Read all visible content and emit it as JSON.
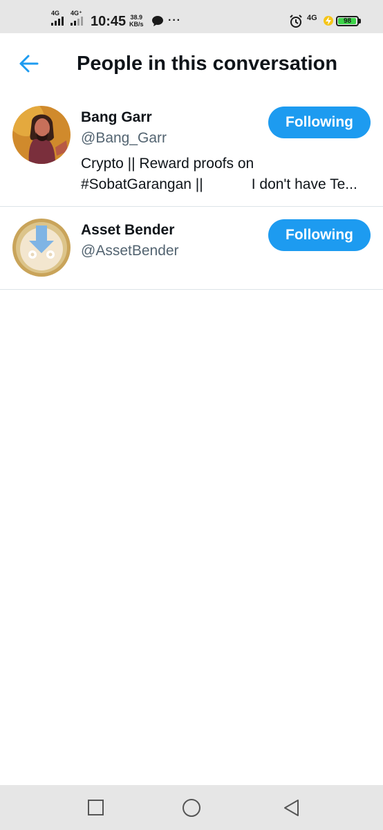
{
  "status_bar": {
    "network_1": "4G",
    "network_2": "4G⁺",
    "time": "10:45",
    "speed_value": "38.9",
    "speed_unit": "KB/s",
    "more": "···",
    "network_right": "4G",
    "battery": "98",
    "battery_level": 0.98,
    "battery_color": "#3dd54a"
  },
  "header": {
    "back_icon": "arrow-left-icon",
    "title": "People in this conversation"
  },
  "users": [
    {
      "name": "Bang Garr",
      "handle": "@Bang_Garr",
      "bio_lines": [
        "Crypto || Reward proofs on",
        "#SobatGarangan ||            I don't have Te..."
      ],
      "button": "Following"
    },
    {
      "name": "Asset Bender",
      "handle": "@AssetBender",
      "bio_lines": [],
      "button": "Following"
    }
  ],
  "nav_bar": {
    "recents": "square-icon",
    "home": "circle-icon",
    "back": "triangle-back-icon"
  },
  "colors": {
    "accent": "#1d9bf0",
    "text_primary": "#0f1419",
    "text_secondary": "#536471",
    "divider": "#dde3e8",
    "system_bar": "#e6e6e6"
  }
}
